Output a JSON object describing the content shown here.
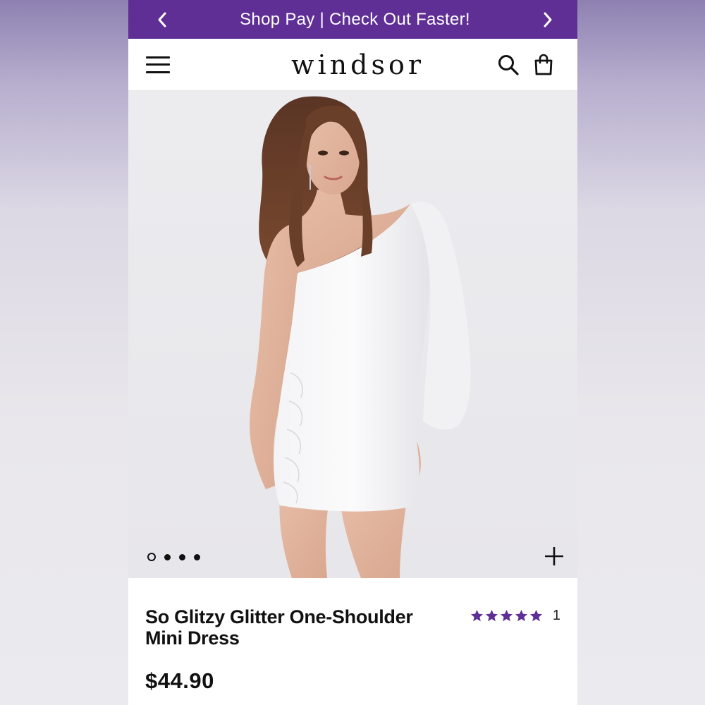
{
  "promo": {
    "text": "Shop Pay | Check Out Faster!",
    "prev_icon": "chevron-left-icon",
    "next_icon": "chevron-right-icon",
    "background": "#5f2f96"
  },
  "header": {
    "logo": "WINDSOR",
    "menu_icon": "hamburger-menu-icon",
    "search_icon": "search-icon",
    "bag_icon": "shopping-bag-icon"
  },
  "gallery": {
    "image_count": 4,
    "active_index": 0,
    "zoom_icon": "plus-icon"
  },
  "product": {
    "title": "So Glitzy Glitter One-Shoulder Mini Dress",
    "rating": 5,
    "review_count": "1",
    "price": "$44.90",
    "star_color": "#5f2f96"
  }
}
